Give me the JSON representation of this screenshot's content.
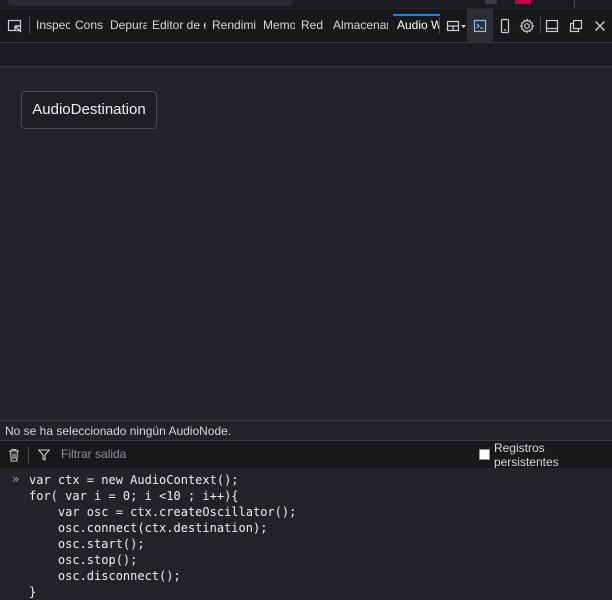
{
  "toolbar": {
    "tabs": [
      "Inspec",
      "Cons",
      "Depura",
      "Editor de e",
      "Rendimi",
      "Memo",
      "Red",
      "Almacenar",
      "Audio W"
    ]
  },
  "graph": {
    "node_label": "AudioDestination"
  },
  "status": {
    "message": "No se ha seleccionado ningún AudioNode."
  },
  "console_bar": {
    "filter_placeholder": "Filtrar salida",
    "persist_label": "Registros persistentes",
    "persist_checked": false
  },
  "console": {
    "prompt": "»",
    "code_lines": [
      "var ctx = new AudioContext();",
      "for( var i = 0; i <10 ; i++){",
      "    var osc = ctx.createOscillator();",
      "    osc.connect(ctx.destination);",
      "    osc.start();",
      "    osc.stop();",
      "    osc.disconnect();",
      "}"
    ]
  },
  "colors": {
    "accent": "#0a84ff",
    "background": "#232327",
    "toolbar": "#18181a"
  }
}
